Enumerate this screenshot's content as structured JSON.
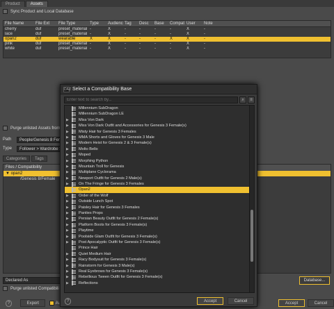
{
  "tabs": [
    "Product",
    "Assets"
  ],
  "sync_label": "Sync Product and Local Database",
  "columns": [
    "File Name",
    "File Ext",
    "File Type",
    "Type",
    "Audience",
    "Tag",
    "Desc",
    "Base",
    "Compat",
    "User",
    "Note"
  ],
  "rows": [
    [
      "cherry",
      "duf",
      "preset_material",
      "-",
      "X",
      "-",
      "-",
      "-",
      "-",
      "X",
      "-"
    ],
    [
      "lace",
      "duf",
      "preset_material",
      "-",
      "X",
      "-",
      "-",
      "-",
      "-",
      "X",
      "-"
    ],
    [
      "opan2",
      "duf",
      "wearable",
      "X",
      "X",
      "-",
      "-",
      "-",
      "X",
      "X",
      "-"
    ],
    [
      "pink",
      "duf",
      "preset_material",
      "-",
      "X",
      "-",
      "-",
      "-",
      "-",
      "X",
      "-"
    ],
    [
      "white",
      "duf",
      "preset_material",
      "-",
      "X",
      "-",
      "-",
      "-",
      "-",
      "X",
      "-"
    ]
  ],
  "purge_label": "Purge unlisted Assets from",
  "path_label": "Path",
  "path_value": "People/Genesis 8 Fema",
  "type_label": "Type",
  "type_value": "Follower > Wardrobe >",
  "subtabs": [
    "Categories",
    "Tags"
  ],
  "files_header": "Files / Compatibility",
  "files": [
    "opan2",
    "/Genesis 8/Female"
  ],
  "declared": "Declared As",
  "purge2_label": "Purge unlisted Compatibili",
  "database_btn": "Database...",
  "export_btn": "Export",
  "auto_label": "Au",
  "accept_btn": "Accept",
  "cancel_btn": "Cancel",
  "dialog": {
    "icon": "DAZ",
    "title": "Select a Compatibility Base",
    "search_placeholder": "Enter text to search by...",
    "accept": "Accept",
    "cancel": "Cancel",
    "items": [
      {
        "t": "Millennium SubDragon",
        "a": false
      },
      {
        "t": "Millennium SubDragon LE",
        "a": false
      },
      {
        "t": "Miss Von Dark",
        "a": true
      },
      {
        "t": "Miss Von Dark Outfit and Accessories for Genesis 3 Female(s)",
        "a": true
      },
      {
        "t": "Misty Hair for Genesis 3 Females",
        "a": true
      },
      {
        "t": "MMA Shorts and Gloves for Genesis 3 Male",
        "a": true
      },
      {
        "t": "Modern Heist for Genesis 2 & 3 Female(s)",
        "a": true
      },
      {
        "t": "Molto Bello",
        "a": true
      },
      {
        "t": "Moped",
        "a": true
      },
      {
        "t": "Morphing Python",
        "a": true
      },
      {
        "t": "Mountain Troll for Genesis",
        "a": true
      },
      {
        "t": "Multiplane Cyclorama",
        "a": true
      },
      {
        "t": "Newport Outfit for Genesis 2 Male(s)",
        "a": true
      },
      {
        "t": "On The Fringe for Genesis 3 Females",
        "a": true
      },
      {
        "t": "Opan2",
        "a": false,
        "sel": true
      },
      {
        "t": "Order of the Wolf",
        "a": true
      },
      {
        "t": "Outside Lunch Spot",
        "a": true
      },
      {
        "t": "Paisley Hair for Genesis 3 Females",
        "a": true
      },
      {
        "t": "Panties Props",
        "a": true
      },
      {
        "t": "Persian Beauty Outfit for Genesis 2 Female(s)",
        "a": true
      },
      {
        "t": "Platform Boots for Genesis 3 Female(s)",
        "a": true
      },
      {
        "t": "Playtime",
        "a": true
      },
      {
        "t": "Poolside Glam Outfit for Genesis 3 Female(s)",
        "a": true
      },
      {
        "t": "Post Apocalyptic Outfit for Genesis 3 Female(s)",
        "a": true
      },
      {
        "t": "Prince Hair",
        "a": false
      },
      {
        "t": "Quiet Medium Hair",
        "a": true
      },
      {
        "t": "Racy Bodysuit for Genesis 3 Female(s)",
        "a": true
      },
      {
        "t": "Rainstorm for Genesis 3 Male(s)",
        "a": true
      },
      {
        "t": "Real Eyebrows for Genesis 3 Female(s)",
        "a": true
      },
      {
        "t": "Rebellious Tween Outfit for Genesis 3 Female(s)",
        "a": true
      },
      {
        "t": "Reflections",
        "a": true
      }
    ]
  }
}
